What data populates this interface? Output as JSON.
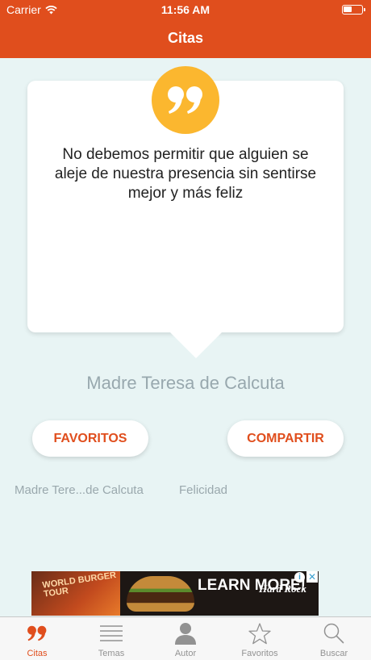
{
  "status_bar": {
    "carrier": "Carrier",
    "time": "11:56 AM"
  },
  "nav": {
    "title": "Citas"
  },
  "quote": {
    "text": "No debemos permitir que alguien se aleje de nuestra presencia sin sentirse mejor y más feliz",
    "author": "Madre Teresa de Calcuta",
    "badge_icon": "quote-marks-icon",
    "badge_color": "#fbb72f"
  },
  "actions": {
    "favorites_label": "FAVORITOS",
    "share_label": "COMPARTIR"
  },
  "tags": {
    "author_tag": "Madre Tere...de Calcuta",
    "topic_tag": "Felicidad"
  },
  "ad": {
    "world_burger_tour": "WORLD BURGER TOUR",
    "headline": "LEARN MORE!",
    "brand": "Hard Rock",
    "info_glyph": "i",
    "close_glyph": "✕"
  },
  "tabs": [
    {
      "label": "Citas",
      "icon": "quote-marks-icon",
      "active": true
    },
    {
      "label": "Temas",
      "icon": "list-icon",
      "active": false
    },
    {
      "label": "Autor",
      "icon": "person-icon",
      "active": false
    },
    {
      "label": "Favoritos",
      "icon": "star-icon",
      "active": false
    },
    {
      "label": "Buscar",
      "icon": "search-icon",
      "active": false
    }
  ],
  "colors": {
    "accent": "#e04e1d",
    "background": "#e8f4f4",
    "badge": "#fbb72f",
    "muted_text": "#98a8ae"
  }
}
